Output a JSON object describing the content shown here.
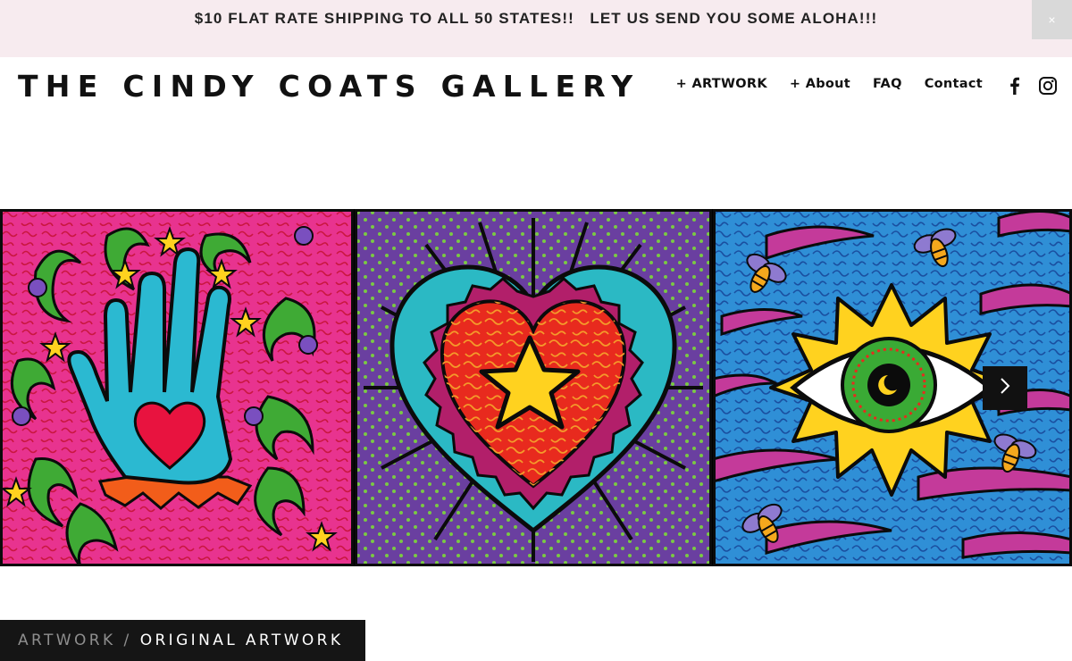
{
  "announcement": {
    "text": "$10 FLAT RATE SHIPPING TO ALL 50 STATES!!   LET US SEND YOU SOME ALOHA!!!",
    "close_label": "×",
    "background": "#f7ebef"
  },
  "header": {
    "site_title": "THE CINDY COATS GALLERY",
    "nav": [
      {
        "label": "+ ARTWORK"
      },
      {
        "label": "+ About"
      },
      {
        "label": "FAQ"
      },
      {
        "label": "Contact"
      }
    ],
    "social_icons": [
      "facebook-icon",
      "instagram-icon"
    ]
  },
  "hero": {
    "panels": [
      {
        "subject": "turquoise hand with red heart on pink background",
        "background": "#e8338f"
      },
      {
        "subject": "red heart with yellow star on purple background",
        "background": "#6a3fa0"
      },
      {
        "subject": "eye in yellow sunburst with bees on blue background",
        "background": "#2f8fd6"
      }
    ],
    "next_icon": "chevron-right-icon"
  },
  "breadcrumb": {
    "parent": "ARTWORK",
    "separator": "/",
    "current": "ORIGINAL ARTWORK"
  }
}
